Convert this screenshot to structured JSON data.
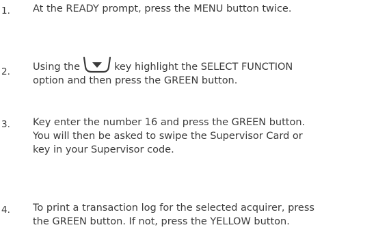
{
  "steps": [
    {
      "number": "1.",
      "lines": [
        "At the READY prompt, press the MENU button twice."
      ]
    },
    {
      "number": "2.",
      "line1_before": "Using the",
      "key_icon": "down-arrow-key-icon",
      "line1_after": "key highlight the SELECT FUNCTION",
      "line2": "option and then press the GREEN button."
    },
    {
      "number": "3.",
      "lines": [
        "Key enter the number 16 and press the GREEN button.",
        "You will then be asked to swipe the Supervisor Card or",
        "key in your Supervisor code."
      ]
    },
    {
      "number": "4.",
      "lines": [
        "To print a transaction log for the selected acquirer, press",
        "the GREEN button. If not, press the YELLOW button."
      ]
    }
  ]
}
